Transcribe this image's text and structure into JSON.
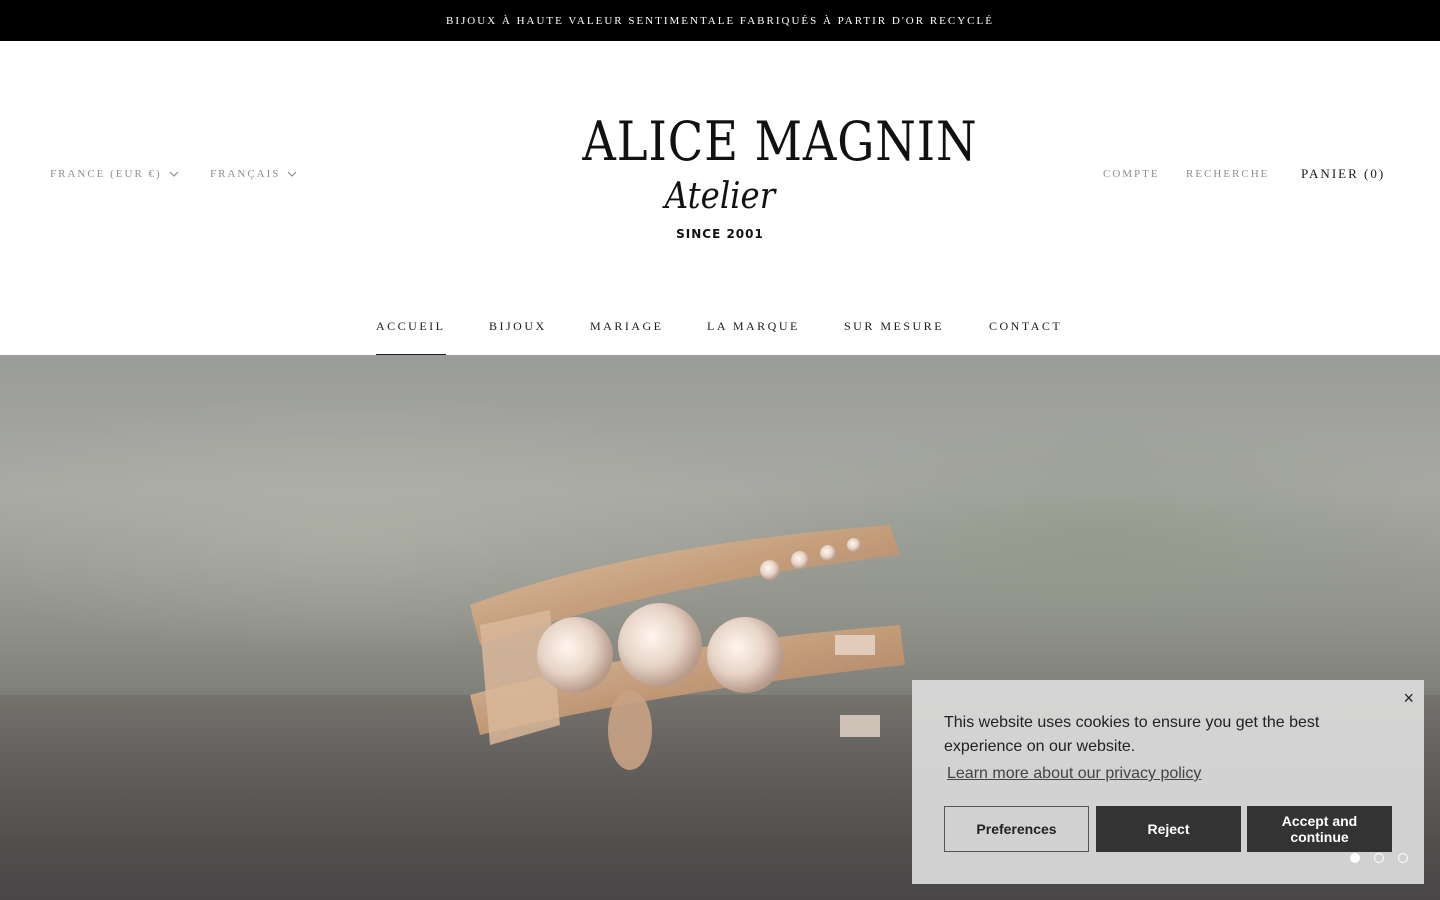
{
  "announcement": {
    "text": "BIJOUX À HAUTE VALEUR SENTIMENTALE FABRIQUÉS À PARTIR D'OR RECYCLÉ"
  },
  "header": {
    "country_label": "FRANCE (EUR €)",
    "language_label": "FRANÇAIS",
    "logo": {
      "main": "ALICE MAGNIN",
      "sub": "Atelier",
      "since": "SINCE 2001"
    },
    "account_label": "COMPTE",
    "search_label": "RECHERCHE",
    "cart_label": "PANIER (0)"
  },
  "nav": {
    "items": [
      {
        "label": "ACCUEIL",
        "active": true
      },
      {
        "label": "BIJOUX"
      },
      {
        "label": "MARIAGE"
      },
      {
        "label": "LA MARQUE"
      },
      {
        "label": "SUR MESURE"
      },
      {
        "label": "CONTACT"
      }
    ]
  },
  "hero": {
    "slides_total": 3,
    "active_slide": 1,
    "image_description_icon": "ring-photo"
  },
  "cookie_banner": {
    "close_label": "×",
    "message": "This website uses cookies to ensure you get the best experience on our website.",
    "link_label": "Learn more about our privacy policy",
    "preferences_label": "Preferences",
    "reject_label": "Reject",
    "accept_label": "Accept and continue"
  },
  "colors": {
    "announcement_bg": "#000000",
    "muted_text": "#8e8e8e",
    "dark_text": "#1c1b1b",
    "button_dark": "#333333"
  }
}
